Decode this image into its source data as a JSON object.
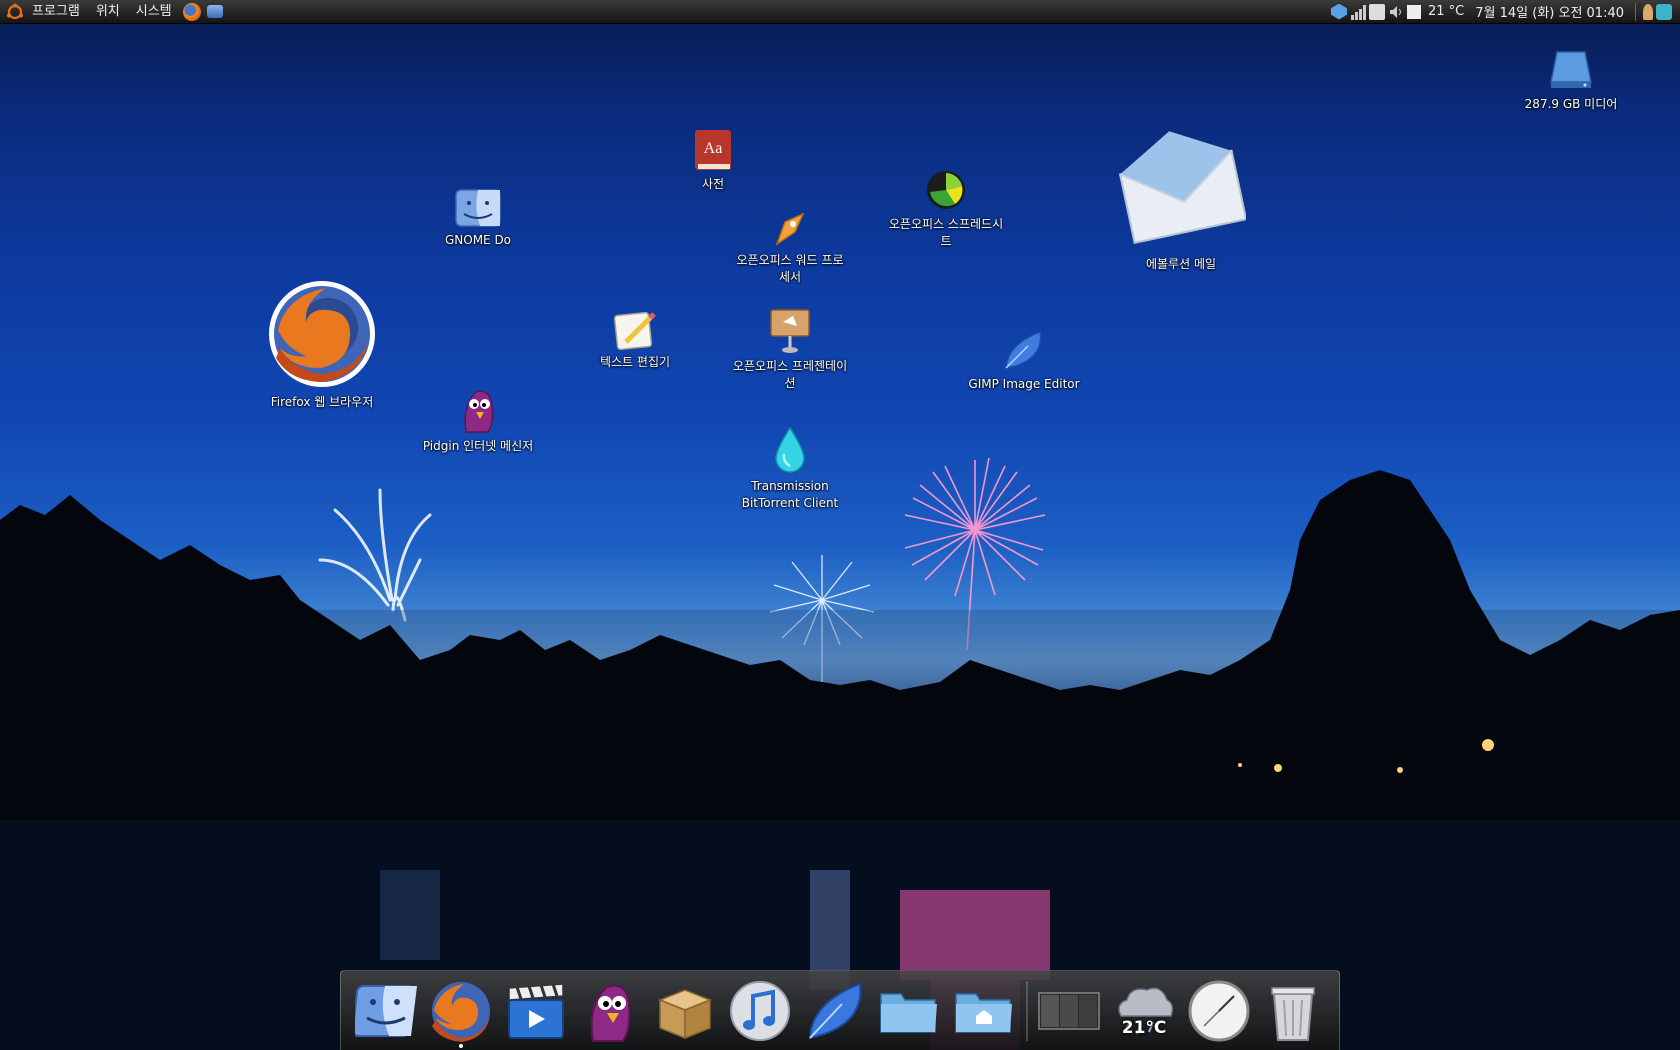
{
  "top_panel": {
    "menus": [
      "프로그램",
      "위치",
      "시스템"
    ],
    "tray": {
      "temperature": "21 °C",
      "datetime": "7월 14일 (화) 오전 01:40"
    }
  },
  "desktop_icons": {
    "drive": "287.9 GB 미디어",
    "dictionary": "사전",
    "gnome_do": "GNOME Do",
    "oo_writer": "오픈오피스 워드 프로\n세서",
    "oo_calc": "오픈오피스 스프레드시\n트",
    "evolution": "에볼루션 메일",
    "firefox": "Firefox 웹 브라우저",
    "text_editor": "텍스트 편집기",
    "oo_impress": "오픈오피스 프레젠테이\n션",
    "gimp": "GIMP Image Editor",
    "pidgin": "Pidgin 인터넷 메신저",
    "transmission": "Transmission\nBitTorrent Client"
  },
  "dock": {
    "weather_temp": "21°C"
  },
  "colors": {
    "panel": "#1e1e1e",
    "sky_top": "#071a4d",
    "sky_mid": "#1147b3"
  }
}
